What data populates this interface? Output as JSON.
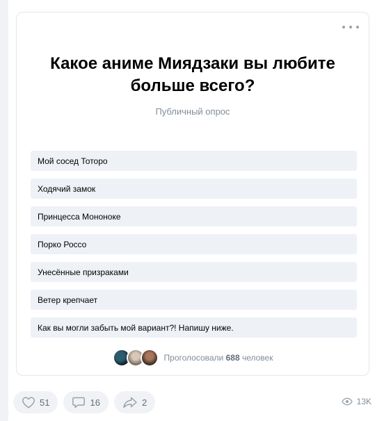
{
  "poll": {
    "title": "Какое аниме Миядзаки вы любите больше всего?",
    "subtitle": "Публичный опрос",
    "options": [
      "Мой сосед Тоторо",
      "Ходячий замок",
      "Принцесса Мононоке",
      "Порко Россо",
      "Унесённые призраками",
      "Ветер крепчает",
      "Как вы могли забыть мой вариант?! Напишу ниже."
    ],
    "voters_prefix": "Проголосовали",
    "voters_count": "688",
    "voters_suffix": "человек"
  },
  "footer": {
    "likes": "51",
    "comments": "16",
    "shares": "2",
    "views": "13K"
  },
  "colors": {
    "text_secondary": "#818c99",
    "option_bg": "#eef2f7",
    "action_bg": "#f0f2f5"
  },
  "icons": [
    "more-dots-icon",
    "heart-icon",
    "comment-icon",
    "share-icon",
    "eye-icon"
  ]
}
